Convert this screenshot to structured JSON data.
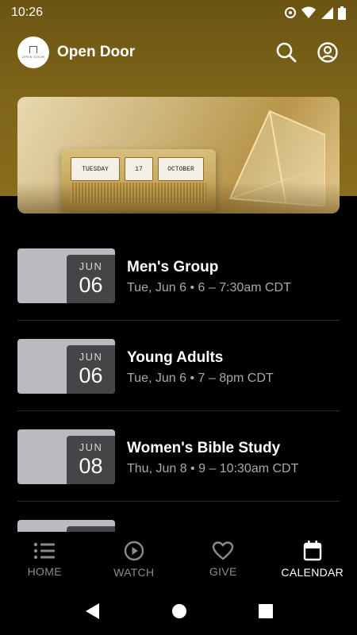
{
  "status_bar": {
    "time": "10:26"
  },
  "header": {
    "title": "Open Door",
    "logo_text": "OPEN DOOR"
  },
  "banner": {
    "day": "TUESDAY",
    "number": "17",
    "month": "OCTOBER"
  },
  "events": [
    {
      "month": "JUN",
      "day": "06",
      "title": "Men's Group",
      "meta": "Tue, Jun 6 • 6 – 7:30am CDT"
    },
    {
      "month": "JUN",
      "day": "06",
      "title": "Young Adults",
      "meta": "Tue, Jun 6 • 7 – 8pm CDT"
    },
    {
      "month": "JUN",
      "day": "08",
      "title": "Women's Bible Study",
      "meta": "Thu, Jun 8 • 9 – 10:30am CDT"
    },
    {
      "month": "",
      "day": "",
      "title": "",
      "meta": ""
    }
  ],
  "nav": {
    "home": "HOME",
    "watch": "WATCH",
    "give": "GIVE",
    "calendar": "CALENDAR",
    "active": "calendar"
  },
  "colors": {
    "hero": "#7d6319",
    "date_tile": "#444547",
    "thumb": "#babbc0"
  }
}
